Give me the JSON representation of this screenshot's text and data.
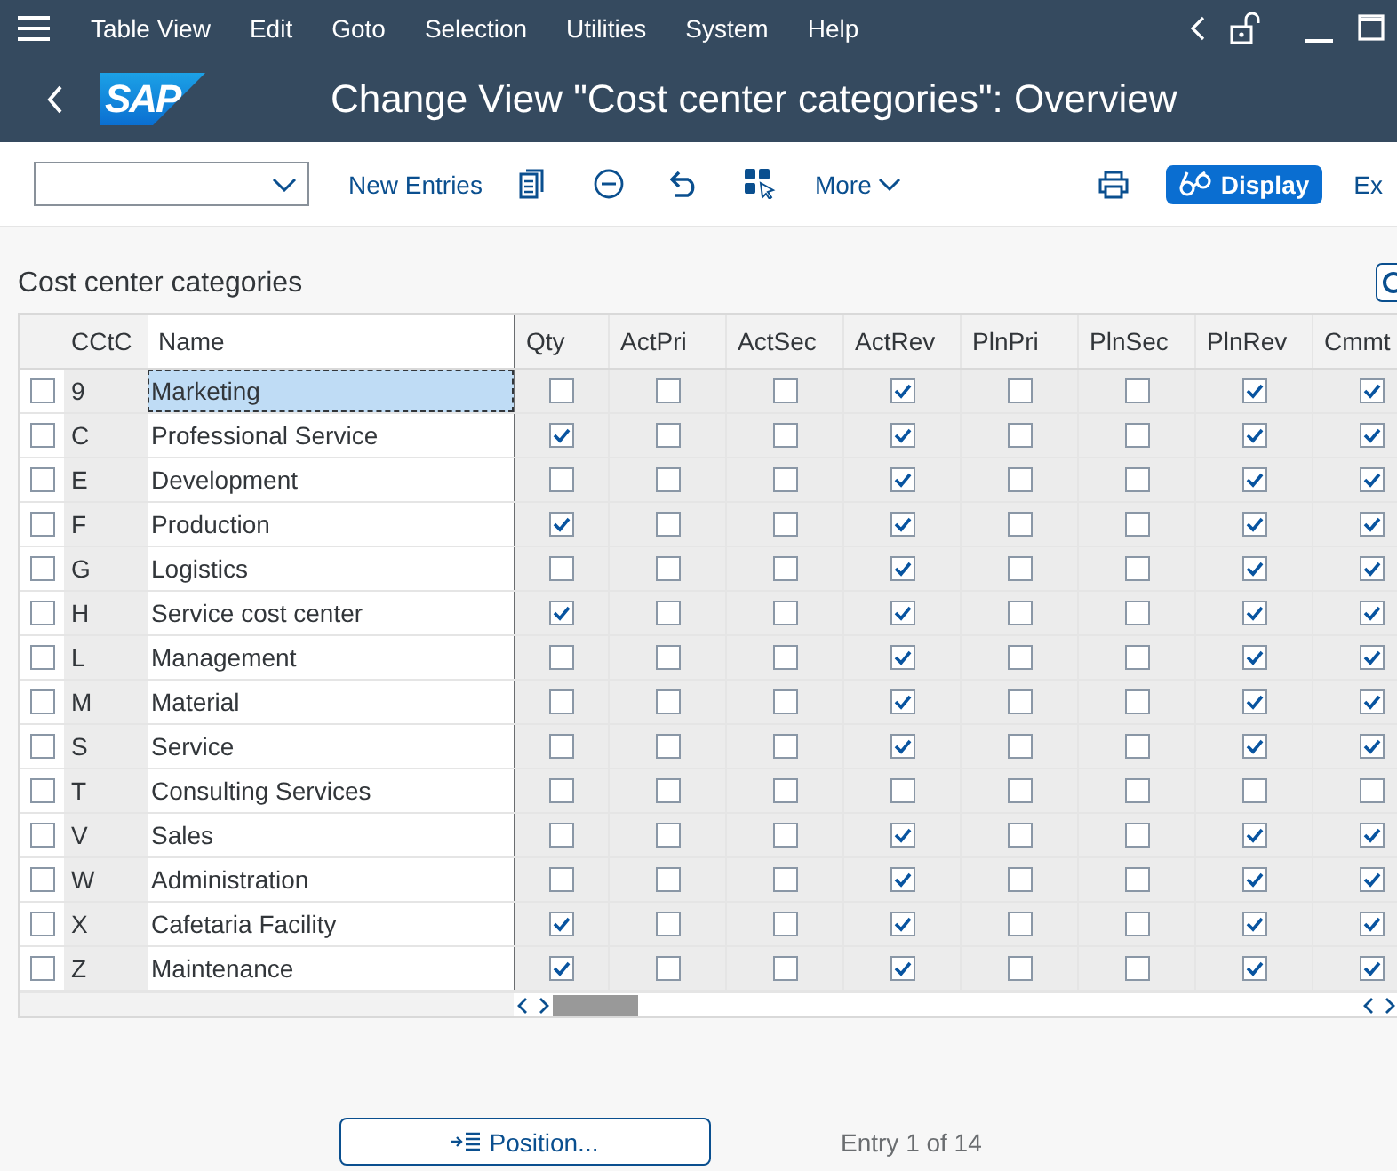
{
  "menu_bar": {
    "items": [
      "Table View",
      "Edit",
      "Goto",
      "Selection",
      "Utilities",
      "System",
      "Help"
    ]
  },
  "title_bar": {
    "logo": "SAP",
    "title": "Change View \"Cost center categories\": Overview"
  },
  "toolbar": {
    "items": [
      {
        "kind": "dropdown"
      },
      {
        "kind": "text",
        "label": "New Entries"
      },
      {
        "kind": "icon"
      },
      {
        "kind": "icon"
      },
      {
        "kind": "icon"
      },
      {
        "kind": "icon"
      },
      {
        "kind": "menu",
        "label": "More"
      },
      {
        "kind": "spacer"
      },
      {
        "kind": "icon"
      },
      {
        "kind": "emphasized",
        "label": "Display"
      },
      {
        "kind": "text",
        "label": "Ex"
      }
    ]
  },
  "table": {
    "title": "Cost center categories",
    "columns": [
      "CCtC",
      "Name",
      "Qty",
      "ActPri",
      "ActSec",
      "ActRev",
      "PlnPri",
      "PlnSec",
      "PlnRev",
      "Cmmt"
    ],
    "rows": [
      {
        "code": "9",
        "name": "Marketing",
        "focused": true,
        "selected": false,
        "flags": [
          false,
          false,
          false,
          true,
          false,
          false,
          true,
          true
        ]
      },
      {
        "code": "C",
        "name": "Professional Service",
        "focused": false,
        "selected": false,
        "flags": [
          true,
          false,
          false,
          true,
          false,
          false,
          true,
          true
        ]
      },
      {
        "code": "E",
        "name": "Development",
        "focused": false,
        "selected": false,
        "flags": [
          false,
          false,
          false,
          true,
          false,
          false,
          true,
          true
        ]
      },
      {
        "code": "F",
        "name": "Production",
        "focused": false,
        "selected": false,
        "flags": [
          true,
          false,
          false,
          true,
          false,
          false,
          true,
          true
        ]
      },
      {
        "code": "G",
        "name": "Logistics",
        "focused": false,
        "selected": false,
        "flags": [
          false,
          false,
          false,
          true,
          false,
          false,
          true,
          true
        ]
      },
      {
        "code": "H",
        "name": "Service cost center",
        "focused": false,
        "selected": false,
        "flags": [
          true,
          false,
          false,
          true,
          false,
          false,
          true,
          true
        ]
      },
      {
        "code": "L",
        "name": "Management",
        "focused": false,
        "selected": false,
        "flags": [
          false,
          false,
          false,
          true,
          false,
          false,
          true,
          true
        ]
      },
      {
        "code": "M",
        "name": "Material",
        "focused": false,
        "selected": false,
        "flags": [
          false,
          false,
          false,
          true,
          false,
          false,
          true,
          true
        ]
      },
      {
        "code": "S",
        "name": "Service",
        "focused": false,
        "selected": false,
        "flags": [
          false,
          false,
          false,
          true,
          false,
          false,
          true,
          true
        ]
      },
      {
        "code": "T",
        "name": "Consulting Services",
        "focused": false,
        "selected": false,
        "flags": [
          false,
          false,
          false,
          false,
          false,
          false,
          false,
          false
        ]
      },
      {
        "code": "V",
        "name": "Sales",
        "focused": false,
        "selected": false,
        "flags": [
          false,
          false,
          false,
          true,
          false,
          false,
          true,
          true
        ]
      },
      {
        "code": "W",
        "name": "Administration",
        "focused": false,
        "selected": false,
        "flags": [
          false,
          false,
          false,
          true,
          false,
          false,
          true,
          true
        ]
      },
      {
        "code": "X",
        "name": "Cafetaria Facility",
        "focused": false,
        "selected": false,
        "flags": [
          true,
          false,
          false,
          true,
          false,
          false,
          true,
          true
        ]
      },
      {
        "code": "Z",
        "name": "Maintenance",
        "focused": false,
        "selected": false,
        "flags": [
          true,
          false,
          false,
          true,
          false,
          false,
          true,
          true
        ]
      }
    ]
  },
  "footer": {
    "position_button": "Position...",
    "entry_info": "Entry 1 of 14"
  }
}
